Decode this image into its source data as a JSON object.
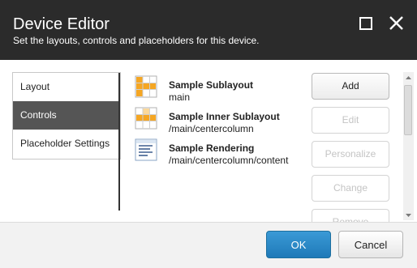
{
  "dialog": {
    "title": "Device Editor",
    "subtitle": "Set the layouts, controls and placeholders for this device."
  },
  "window_controls": {
    "maximize_icon": "maximize-icon",
    "close_icon": "close-icon"
  },
  "tabs": [
    {
      "label": "Layout",
      "active": false
    },
    {
      "label": "Controls",
      "active": true
    },
    {
      "label": "Placeholder Settings",
      "active": false
    }
  ],
  "controls": [
    {
      "name": "Sample Sublayout",
      "path": "main",
      "icon": "sublayout-icon"
    },
    {
      "name": "Sample Inner Sublayout",
      "path": "/main/centercolumn",
      "icon": "inner-sublayout-icon"
    },
    {
      "name": "Sample Rendering",
      "path": "/main/centercolumn/content",
      "icon": "rendering-icon"
    }
  ],
  "side_buttons": {
    "add": "Add",
    "edit": "Edit",
    "personalize": "Personalize",
    "change": "Change",
    "remove": "Remove"
  },
  "footer": {
    "ok": "OK",
    "cancel": "Cancel"
  },
  "colors": {
    "header_bg": "#2b2b2b",
    "active_tab_bg": "#555555",
    "ok_button": "#2b8ac9",
    "icon_orange": "#f5a623"
  }
}
